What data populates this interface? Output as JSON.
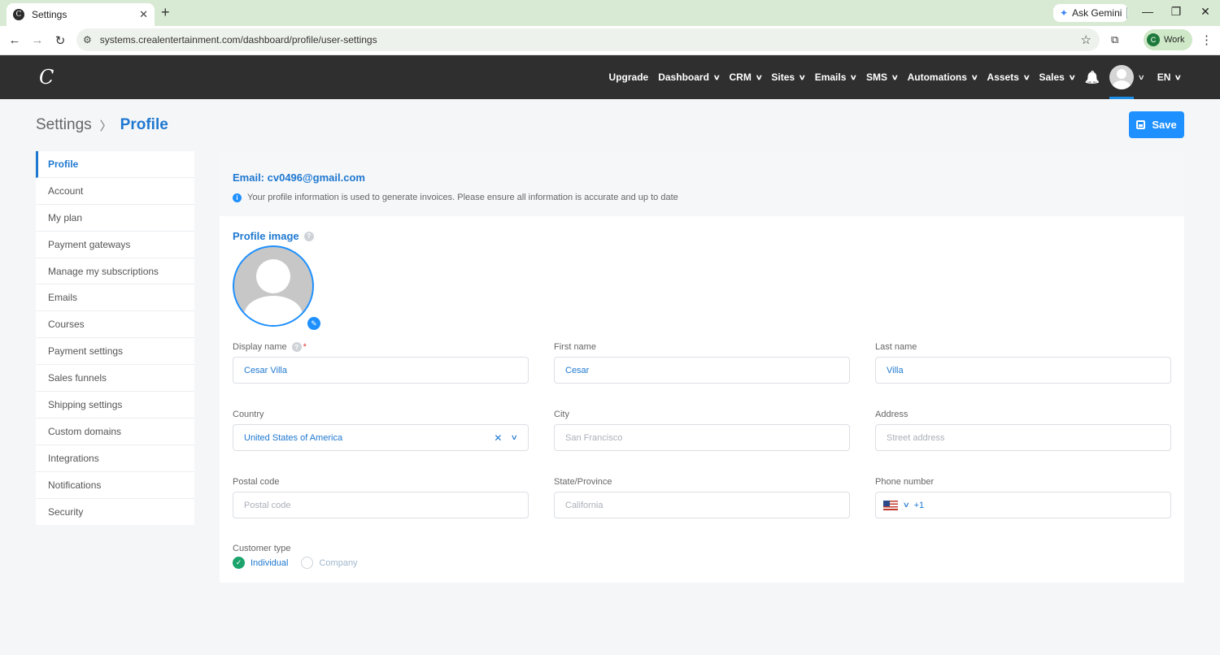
{
  "browser": {
    "tab_title": "Settings",
    "tab_close": "✕",
    "new_tab": "+",
    "url": "systems.crealentertainment.com/dashboard/profile/user-settings",
    "ask_gemini": "Ask Gemini",
    "profile_initial": "C",
    "profile_label": "Work",
    "favicon_letter": "C"
  },
  "topnav": {
    "logo": "C",
    "items": [
      {
        "label": "Upgrade",
        "has_dropdown": false
      },
      {
        "label": "Dashboard",
        "has_dropdown": true
      },
      {
        "label": "CRM",
        "has_dropdown": true
      },
      {
        "label": "Sites",
        "has_dropdown": true
      },
      {
        "label": "Emails",
        "has_dropdown": true
      },
      {
        "label": "SMS",
        "has_dropdown": true
      },
      {
        "label": "Automations",
        "has_dropdown": true
      },
      {
        "label": "Assets",
        "has_dropdown": true
      },
      {
        "label": "Sales",
        "has_dropdown": true
      }
    ],
    "language": "EN",
    "accent_color": "#1c8ee8"
  },
  "page": {
    "breadcrumb_root": "Settings",
    "breadcrumb_current": "Profile",
    "save_label": "Save"
  },
  "sidebar": {
    "items": [
      {
        "label": "Profile",
        "active": true
      },
      {
        "label": "Account"
      },
      {
        "label": "My plan"
      },
      {
        "label": "Payment gateways"
      },
      {
        "label": "Manage my subscriptions"
      },
      {
        "label": "Emails"
      },
      {
        "label": "Courses"
      },
      {
        "label": "Payment settings"
      },
      {
        "label": "Sales funnels"
      },
      {
        "label": "Shipping settings"
      },
      {
        "label": "Custom domains"
      },
      {
        "label": "Integrations"
      },
      {
        "label": "Notifications"
      },
      {
        "label": "Security"
      }
    ]
  },
  "profile": {
    "email_line": "Email: cv0496@gmail.com",
    "info_text": "Your profile information is used to generate invoices. Please ensure all information is accurate and up to date",
    "profile_image_title": "Profile image",
    "fields": {
      "display_name": {
        "label": "Display name",
        "value": "Cesar Villa",
        "required": "*"
      },
      "first_name": {
        "label": "First name",
        "value": "Cesar"
      },
      "last_name": {
        "label": "Last name",
        "value": "Villa"
      },
      "country": {
        "label": "Country",
        "value": "United States of America"
      },
      "city": {
        "label": "City",
        "placeholder": "San Francisco"
      },
      "address": {
        "label": "Address",
        "placeholder": "Street address"
      },
      "postal_code": {
        "label": "Postal code",
        "placeholder": "Postal code"
      },
      "state": {
        "label": "State/Province",
        "placeholder": "California"
      },
      "phone": {
        "label": "Phone number",
        "dial_code": "+1"
      }
    },
    "customer_type": {
      "label": "Customer type",
      "options": [
        {
          "label": "Individual",
          "selected": true
        },
        {
          "label": "Company",
          "selected": false
        }
      ]
    }
  }
}
